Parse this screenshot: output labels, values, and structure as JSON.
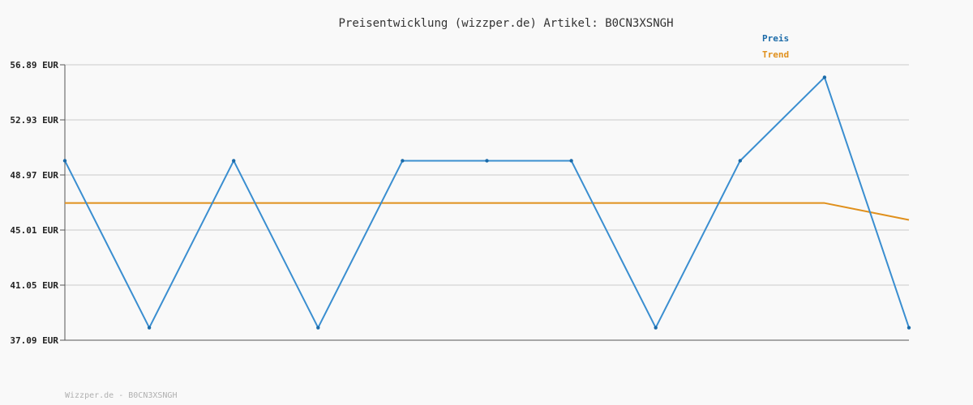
{
  "chart_data": {
    "type": "line",
    "title": "Preisentwicklung (wizzper.de) Artikel: B0CN3XSNGH",
    "xlabel": "",
    "ylabel": "",
    "x": [
      0,
      1,
      2,
      3,
      4,
      5,
      6,
      7,
      8,
      9,
      10
    ],
    "y_ticks": [
      37.09,
      41.05,
      45.01,
      48.97,
      52.93,
      56.89
    ],
    "y_tick_labels": [
      "37.09 EUR",
      "41.05 EUR",
      "45.01 EUR",
      "48.97 EUR",
      "52.93 EUR",
      "56.89 EUR"
    ],
    "ylim": [
      37.09,
      56.89
    ],
    "grid": true,
    "legend_position": "top-right",
    "series": [
      {
        "name": "Preis",
        "color": "#3a8ed0",
        "marker_color": "#1a6aa8",
        "values": [
          49.99,
          37.99,
          49.99,
          37.99,
          49.99,
          49.99,
          49.99,
          37.99,
          49.99,
          55.99,
          37.99
        ]
      },
      {
        "name": "Trend",
        "color": "#e0901c",
        "values": [
          46.95,
          46.95,
          46.95,
          46.95,
          46.95,
          46.95,
          46.95,
          46.95,
          46.95,
          46.95,
          45.74
        ]
      }
    ],
    "footer": "Wizzper.de - B0CN3XSNGH"
  }
}
